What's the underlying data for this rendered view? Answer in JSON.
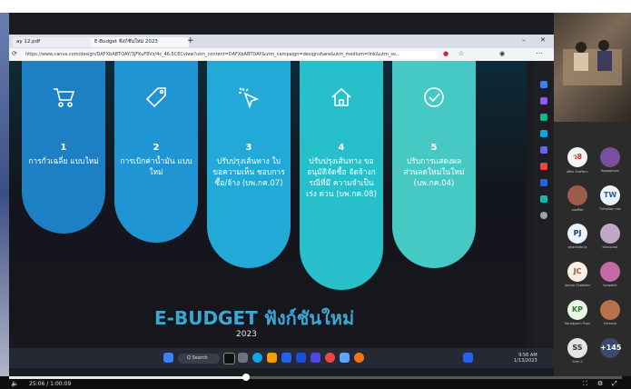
{
  "browser": {
    "tabs": [
      "ay 12.pdf",
      "E-Budget ฟังก์ชันใหม่ 2023"
    ],
    "url": "https://www.canva.com/design/DAFXbABTOAY/3jFKuF8Vz/4c_46.5CECview?utm_content=DAFXbABTOAY&utm_campaign=designshare&utm_medium=link&utm_so..."
  },
  "slide": {
    "cards": [
      {
        "num": "1",
        "label": "การกั่วเฉลี่ย แบบใหม่",
        "icon": "cart-icon",
        "color": "#1d7fc4"
      },
      {
        "num": "2",
        "label": "การเบิกค่าน้ำมัน แบบใหม่",
        "icon": "tag-icon",
        "color": "#1f95d3"
      },
      {
        "num": "3",
        "label": "ปรับปรุงเส้นทาง ใบขอความเห็น ชอบการซื้อ/จ้าง (บพ.กค.07)",
        "icon": "click-icon",
        "color": "#22a9d8"
      },
      {
        "num": "4",
        "label": "ปรับปรุงเส้นทาง ขออนุมัติจัดซื้อ จัดจ้างกรณีที่มี ความจำเป็นเร่ง ด่วน (บพ.กค.08)",
        "icon": "home-icon",
        "color": "#27bfc9"
      },
      {
        "num": "5",
        "label": "ปรับการแสดงผล ส่วนลดใหม่ในใหม่ (บพ.กค.04)",
        "icon": "check-icon",
        "color": "#46c9c5"
      }
    ],
    "title": "E-BUDGET ฟังก์ชันใหม่",
    "year": "2023"
  },
  "taskbar": {
    "search": "Q Search",
    "time": "9:56 AM",
    "date": "1/13/2023"
  },
  "participants": [
    {
      "initials": "ว8",
      "name": "อธิพร จันทร์ตระ",
      "color": "#f3f3f3",
      "text": "#c0392b"
    },
    {
      "initials": "",
      "name": "Yoppaphorn",
      "color": "#7a4fa0",
      "text": "#fff"
    },
    {
      "initials": "",
      "name": "มนฤดีพร",
      "color": "#9b5c4a",
      "text": "#fff"
    },
    {
      "initials": "TW",
      "name": "Thitiphon nan",
      "color": "#eaf2fb",
      "text": "#2c5aa0"
    },
    {
      "initials": "PJ",
      "name": "phanitida ja",
      "color": "#eaf2fb",
      "text": "#1b3d6e"
    },
    {
      "initials": "",
      "name": "kitisuchat",
      "color": "#bfa7c8",
      "text": "#fff"
    },
    {
      "initials": "JC",
      "name": "Jamon Chatkaew",
      "color": "#fbeee5",
      "text": "#b0502a"
    },
    {
      "initials": "",
      "name": "kpapaint",
      "color": "#c46aa0",
      "text": "#fff"
    },
    {
      "initials": "KP",
      "name": "Kanokporn Pupat",
      "color": "#e8f6e6",
      "text": "#2e7d32"
    },
    {
      "initials": "",
      "name": "kritsana",
      "color": "#b7714b",
      "text": "#fff"
    },
    {
      "initials": "SS",
      "name": "Sirin S",
      "color": "#e5e5e5",
      "text": "#333"
    },
    {
      "initials": "+145",
      "name": "",
      "color": "#3a4a6b",
      "text": "#fff"
    }
  ],
  "player": {
    "time": "25:06 / 1:00:09",
    "progress": 0.387
  }
}
